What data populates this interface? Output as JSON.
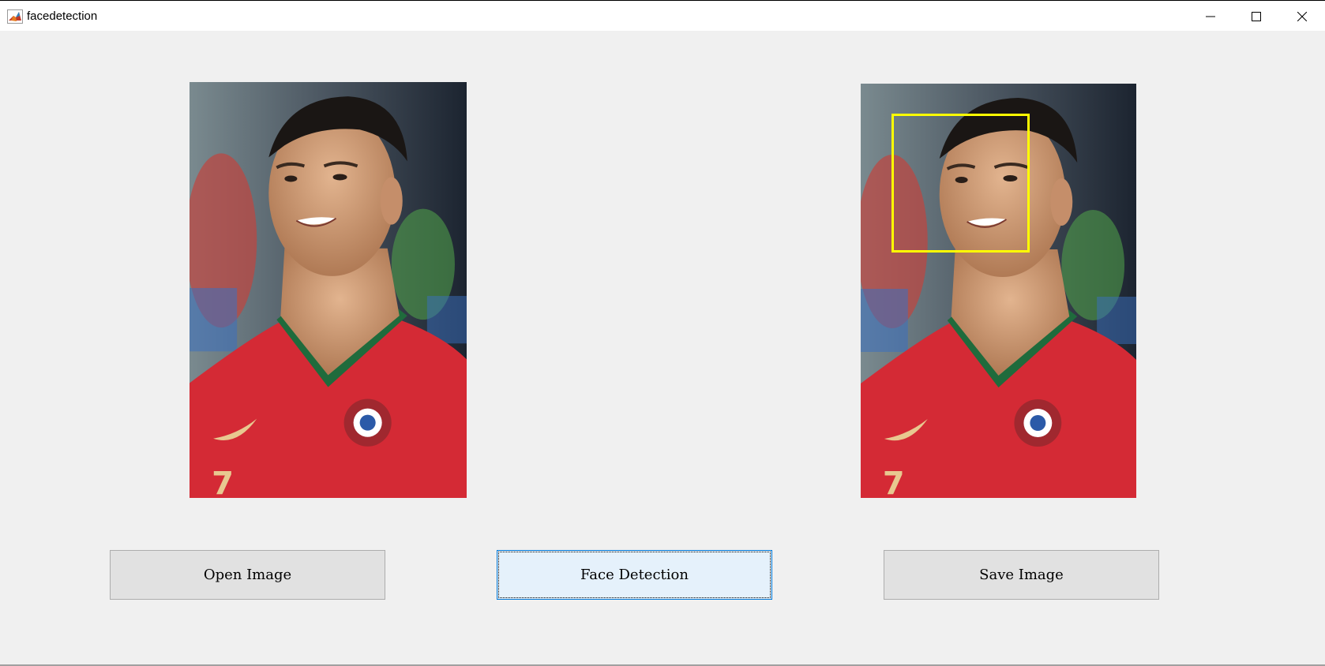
{
  "window": {
    "title": "facedetection",
    "app_icon": "matlab-icon",
    "controls": {
      "minimize": "minimize-icon",
      "maximize": "maximize-icon",
      "close": "close-icon"
    }
  },
  "images": {
    "original": {
      "description_icon": "photo-original",
      "has_face_box": false
    },
    "result": {
      "description_icon": "photo-result",
      "has_face_box": true,
      "box_color": "#ffff00"
    }
  },
  "buttons": {
    "open_label": "Open Image",
    "detect_label": "Face Detection",
    "save_label": "Save Image"
  },
  "colors": {
    "background": "#f0f0f0",
    "button_face": "#e1e1e1",
    "focused_button_face": "#e5f1fb",
    "focus_border": "#0078d7",
    "jersey_red": "#d42a35",
    "collar_green": "#1f6b3c"
  }
}
